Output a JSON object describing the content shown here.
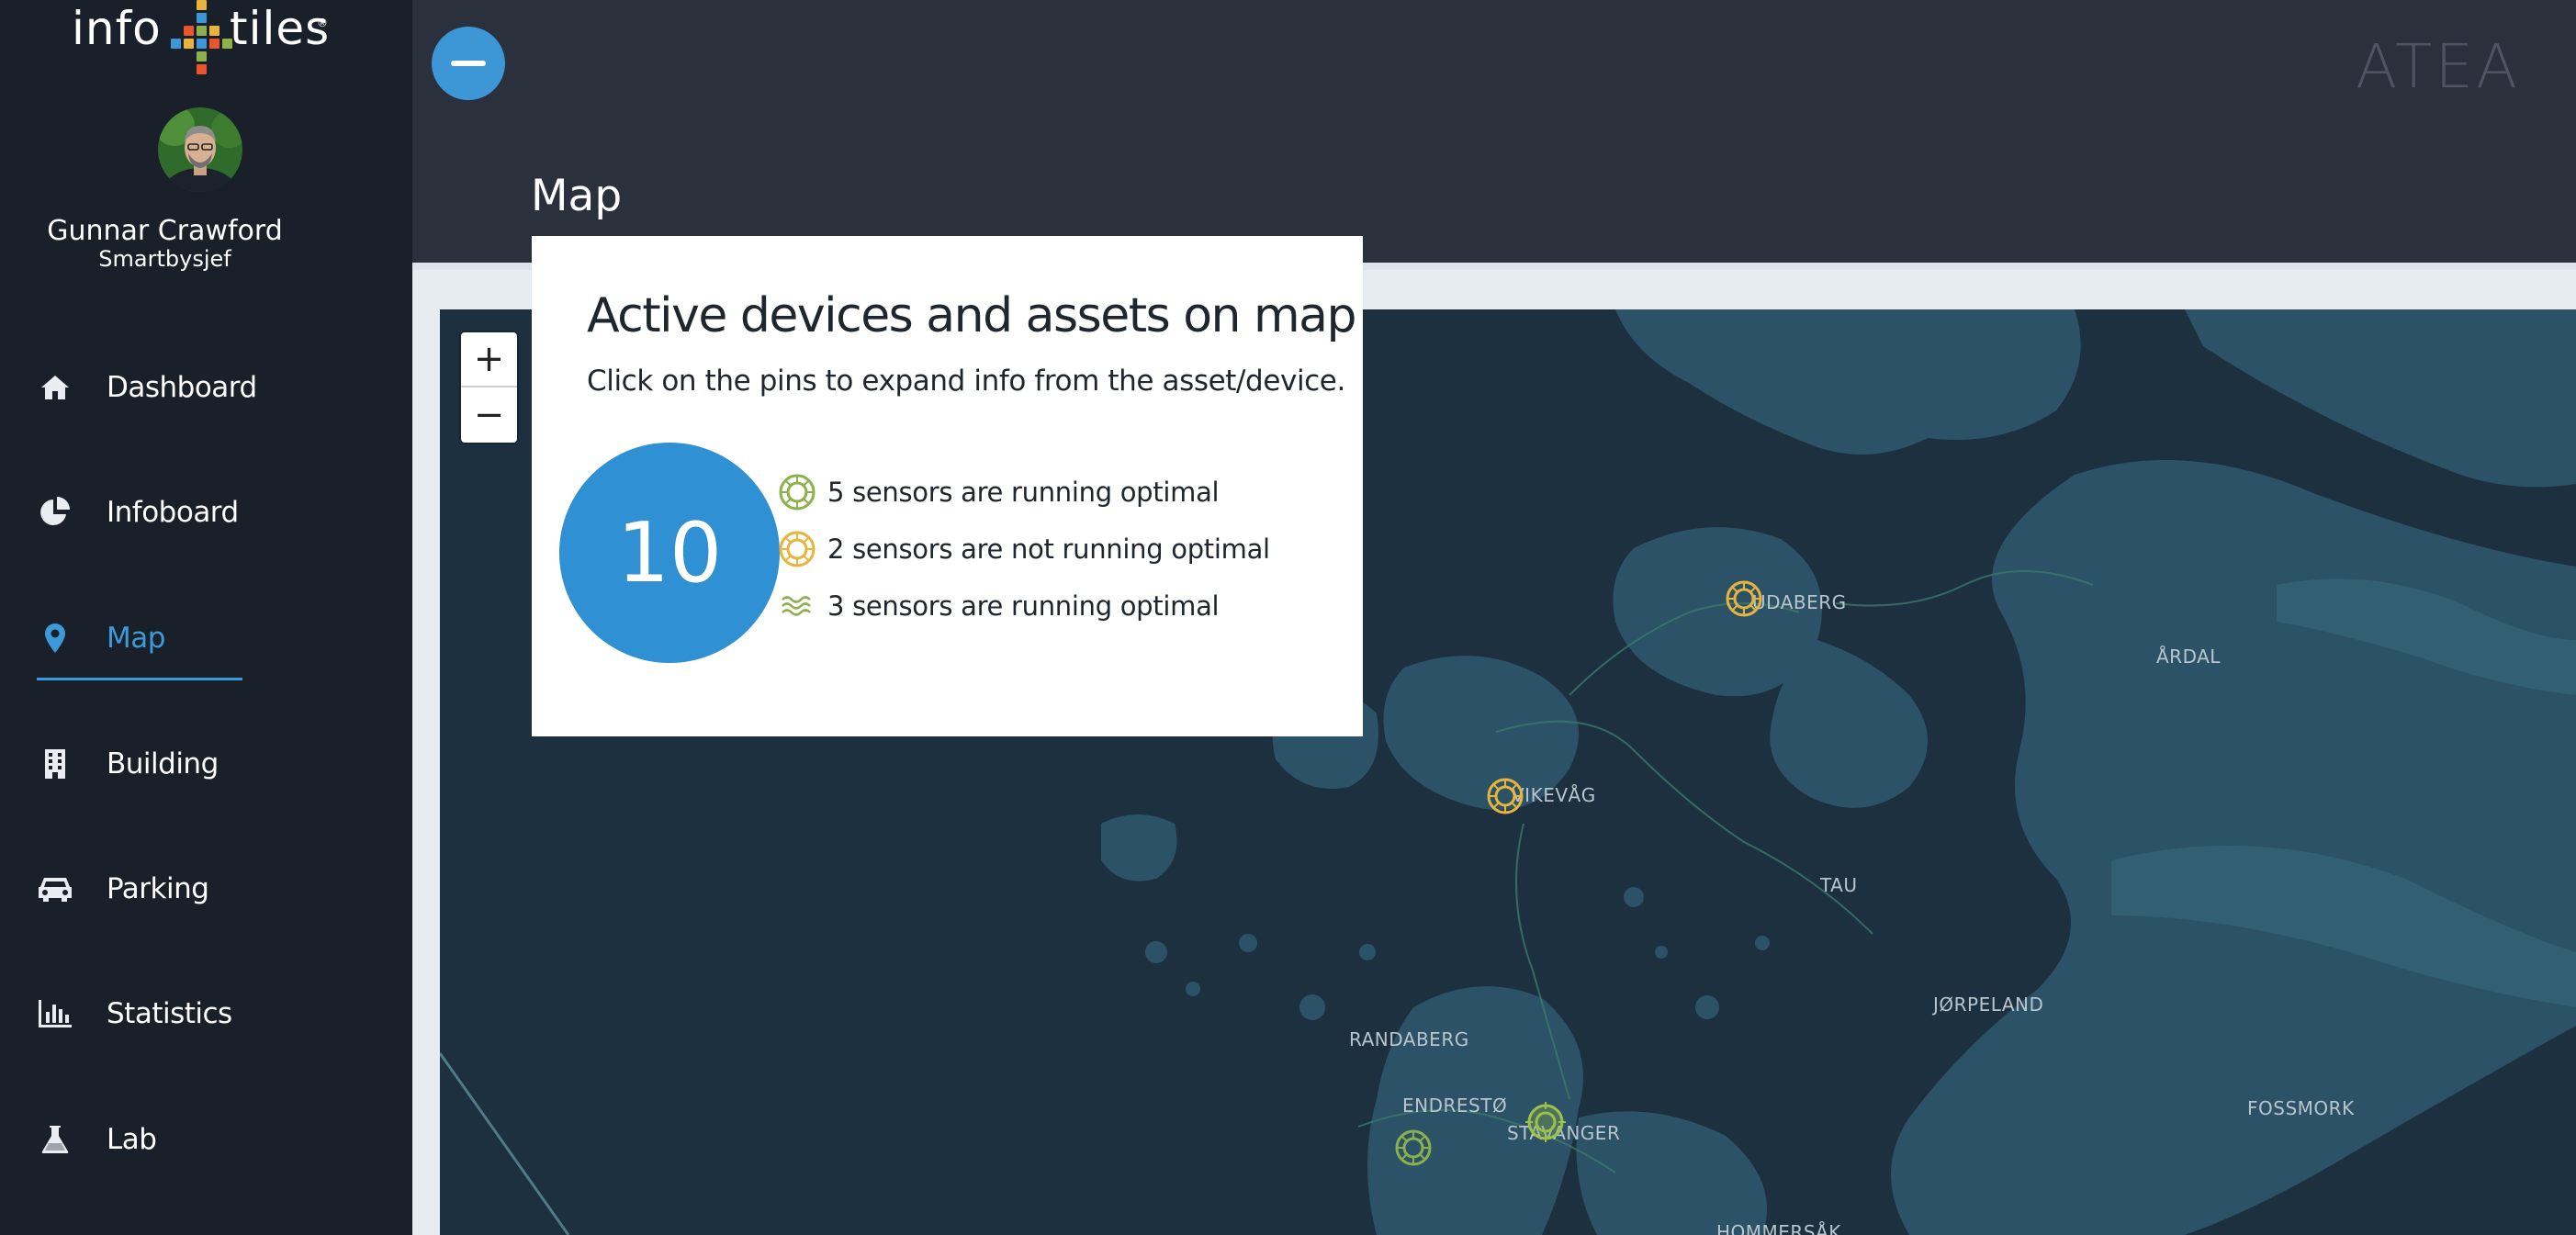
{
  "app": {
    "logo_left": "info",
    "logo_right": "tiles",
    "logo_reg": "®",
    "brand": "ATEA"
  },
  "user": {
    "name": "Gunnar Crawford",
    "role": "Smartbysjef"
  },
  "nav": {
    "items": [
      {
        "label": "Dashboard",
        "icon": "home-icon"
      },
      {
        "label": "Infoboard",
        "icon": "pie-chart-icon"
      },
      {
        "label": "Map",
        "icon": "map-pin-icon",
        "active": true
      },
      {
        "label": "Building",
        "icon": "building-icon"
      },
      {
        "label": "Parking",
        "icon": "car-icon"
      },
      {
        "label": "Statistics",
        "icon": "bar-chart-icon"
      },
      {
        "label": "Lab",
        "icon": "flask-icon"
      }
    ]
  },
  "page": {
    "title": "Map"
  },
  "map": {
    "zoom_in": "+",
    "zoom_out": "−",
    "places": [
      "UDABERG",
      "ÅRDAL",
      "VIKEVÅG",
      "TAU",
      "JØRPELAND",
      "RANDABERG",
      "ENDRESTØ",
      "STAVANGER",
      "FOSSMORK",
      "HOMMERSÅK"
    ]
  },
  "card": {
    "title": "Active devices and assets on map",
    "subtitle": "Click on the pins to expand info from the asset/device.",
    "count": "10",
    "legend": [
      {
        "text": "5 sensors are running optimal",
        "icon": "sensor-ok-icon",
        "color": "#8db04a"
      },
      {
        "text": "2 sensors are not running optimal",
        "icon": "sensor-warning-icon",
        "color": "#e8b43c"
      },
      {
        "text": "3 sensors are running optimal",
        "icon": "water-wave-icon",
        "color": "#8db04a"
      }
    ]
  },
  "colors": {
    "accent": "#3d9ad9",
    "sidebar": "#192029",
    "header": "#2a303c",
    "map_water": "#1d3040",
    "map_land": "#2c5268",
    "ok": "#8db04a",
    "warning": "#e8b43c"
  }
}
